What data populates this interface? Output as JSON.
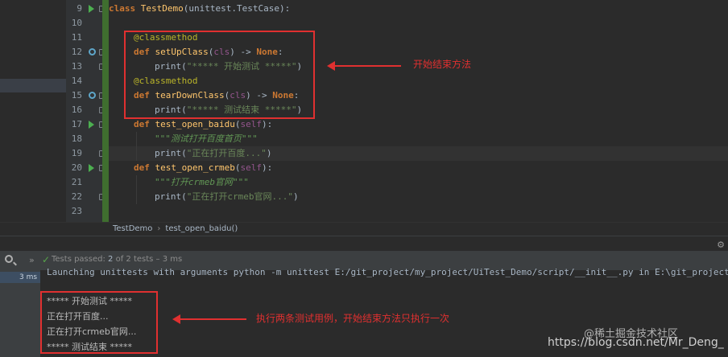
{
  "code_lines": [
    {
      "num": "9"
    },
    {
      "num": "10"
    },
    {
      "num": "11"
    },
    {
      "num": "12"
    },
    {
      "num": "13"
    },
    {
      "num": "14"
    },
    {
      "num": "15"
    },
    {
      "num": "16"
    },
    {
      "num": "17"
    },
    {
      "num": "18"
    },
    {
      "num": "19"
    },
    {
      "num": "20"
    },
    {
      "num": "21"
    },
    {
      "num": "22"
    },
    {
      "num": "23"
    }
  ],
  "code": {
    "l9_kw": "class",
    "l9_name": "TestDemo",
    "l9_rest": "(unittest.TestCase):",
    "l11": "@classmethod",
    "l12_kw": "def",
    "l12_name": "setUpClass",
    "l12_cls": "cls",
    "l12_arrow": ") -> ",
    "l12_none": "None",
    "l12_colon": ":",
    "l13_fn": "print",
    "l13_str": "\"***** 开始测试 *****\"",
    "l14": "@classmethod",
    "l15_kw": "def",
    "l15_name": "tearDownClass",
    "l15_cls": "cls",
    "l15_arrow": ") -> ",
    "l15_none": "None",
    "l15_colon": ":",
    "l16_fn": "print",
    "l16_str": "\"***** 测试结束 *****\"",
    "l17_kw": "def",
    "l17_name": "test_open_baidu",
    "l17_self": "self",
    "l18_doc": "\"\"\"测试打开百度首页\"\"\"",
    "l19_fn": "print",
    "l19_str": "\"正在打开百度...\"",
    "l20_kw": "def",
    "l20_name": "test_open_crmeb",
    "l20_self": "self",
    "l21_doc": "\"\"\"打开crmeb官网\"\"\"",
    "l22_fn": "print",
    "l22_str": "\"正在打开crmeb官网...\""
  },
  "annotations": {
    "top_note": "开始结束方法",
    "bottom_note": "执行两条测试用例，开始结束方法只执行一次"
  },
  "breadcrumb": {
    "class": "TestDemo",
    "method": "test_open_baidu()"
  },
  "run_panel": {
    "status_prefix": "Tests passed:",
    "passed": "2",
    "status_rest": "of 2 tests – 3 ms",
    "time_chip": "3 ms"
  },
  "console": {
    "launch": "Launching unittests with arguments python -m unittest E:/git_project/my_project/UiTest_Demo/script/__init__.py in E:\\git_project",
    "line1": "***** 开始测试 *****",
    "line2": "正在打开百度...",
    "line3": "正在打开crmeb官网...",
    "line4": "***** 测试结束 *****"
  },
  "watermarks": {
    "a": "@稀土掘金技术社区",
    "b": "https://blog.csdn.net/Mr_Deng_"
  },
  "colors": {
    "annotation": "#e03030",
    "keyword": "#cc7832",
    "string": "#6a8759",
    "function": "#ffc66d"
  }
}
